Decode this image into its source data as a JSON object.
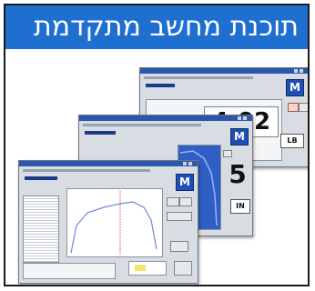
{
  "banner": {
    "title": "תוכנת מחשב מתקדמת"
  },
  "windows": {
    "back": {
      "reading_main": "4.02",
      "reading_unit": "LB",
      "logo": "M"
    },
    "middle": {
      "reading_main": "5",
      "reading_unit": "IN",
      "logo": "M"
    },
    "front": {
      "logo": "M"
    }
  },
  "colors": {
    "banner": "#1f6fd1",
    "chart_fill": "#2f5fc4",
    "curve": "#6f86d8",
    "marker": "#e06a6a"
  }
}
